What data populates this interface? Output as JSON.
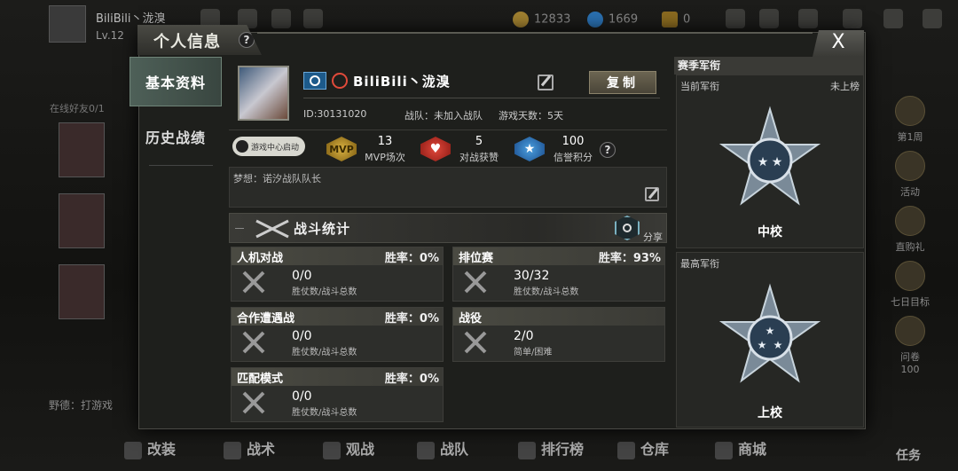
{
  "hud": {
    "player_name": "BiliBili丶泷溴",
    "level": "Lv.12",
    "gold": "12833",
    "diamonds": "1669",
    "tickets": "0"
  },
  "left_strip": {
    "friends_online": "在线好友0/1",
    "chat_text": "野德：打游戏"
  },
  "right_strip": {
    "items": [
      "第1周",
      "活动",
      "直购礼",
      "七日目标",
      "问卷"
    ],
    "small_value": "100"
  },
  "bottom_nav": [
    "改装",
    "战术",
    "观战",
    "战队",
    "排行榜",
    "仓库",
    "商城",
    "任务"
  ],
  "dialog": {
    "title": "个人信息",
    "help": "?",
    "close": "X"
  },
  "side_nav": {
    "basic": "基本资料",
    "history": "历史战绩"
  },
  "profile": {
    "name": "BiliBili丶泷溴",
    "copy_label": "复制",
    "id": "ID:30131020",
    "team": "战队：未加入战队",
    "days": "游戏天数：5天",
    "game_center": "游戏中心启动",
    "motto": "梦想：诺汐战队队长"
  },
  "stats": [
    {
      "badge": "MVP",
      "value": "13",
      "label": "MVP场次"
    },
    {
      "badge": "heart",
      "value": "5",
      "label": "对战获赞"
    },
    {
      "badge": "star",
      "value": "100",
      "label": "信誉积分"
    }
  ],
  "battle": {
    "title": "战斗统计",
    "share": "分享",
    "cards": [
      {
        "name": "人机对战",
        "winrate": "胜率：0%",
        "value": "0/0",
        "sub": "胜仗数/战斗总数"
      },
      {
        "name": "排位赛",
        "winrate": "胜率：93%",
        "value": "30/32",
        "sub": "胜仗数/战斗总数"
      },
      {
        "name": "合作遭遇战",
        "winrate": "胜率：0%",
        "value": "0/0",
        "sub": "胜仗数/战斗总数"
      },
      {
        "name": "战役",
        "winrate": "",
        "value": "2/0",
        "sub": "简单/困难"
      },
      {
        "name": "匹配模式",
        "winrate": "胜率：0%",
        "value": "0/0",
        "sub": "胜仗数/战斗总数"
      }
    ]
  },
  "ranks": {
    "header": "赛季军衔",
    "current_label": "当前军衔",
    "current_status": "未上榜",
    "current_rank": "中校",
    "highest_label": "最高军衔",
    "highest_rank": "上校"
  },
  "colors": {
    "accent_green": "#4e6058",
    "mvp_gold": "#d8b040",
    "heart_red": "#e0473a",
    "star_blue": "#4aa0e0"
  }
}
